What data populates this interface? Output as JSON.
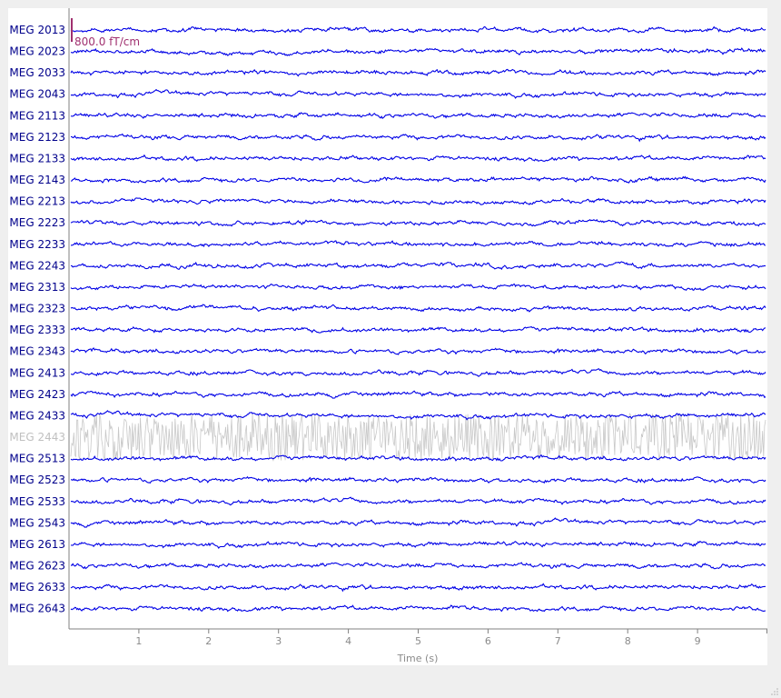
{
  "chart_data": {
    "type": "line",
    "title": "",
    "xlabel": "Time (s)",
    "ylabel": "",
    "xlim": [
      0,
      10
    ],
    "xticks": [
      1,
      2,
      3,
      4,
      5,
      6,
      7,
      8,
      9
    ],
    "scale_bar_label": "800.0 fT/cm",
    "channels": [
      {
        "name": "MEG 2013",
        "bad": false
      },
      {
        "name": "MEG 2023",
        "bad": false
      },
      {
        "name": "MEG 2033",
        "bad": false
      },
      {
        "name": "MEG 2043",
        "bad": false
      },
      {
        "name": "MEG 2113",
        "bad": false
      },
      {
        "name": "MEG 2123",
        "bad": false
      },
      {
        "name": "MEG 2133",
        "bad": false
      },
      {
        "name": "MEG 2143",
        "bad": false
      },
      {
        "name": "MEG 2213",
        "bad": false
      },
      {
        "name": "MEG 2223",
        "bad": false
      },
      {
        "name": "MEG 2233",
        "bad": false
      },
      {
        "name": "MEG 2243",
        "bad": false
      },
      {
        "name": "MEG 2313",
        "bad": false
      },
      {
        "name": "MEG 2323",
        "bad": false
      },
      {
        "name": "MEG 2333",
        "bad": false
      },
      {
        "name": "MEG 2343",
        "bad": false
      },
      {
        "name": "MEG 2413",
        "bad": false
      },
      {
        "name": "MEG 2423",
        "bad": false
      },
      {
        "name": "MEG 2433",
        "bad": false
      },
      {
        "name": "MEG 2443",
        "bad": true
      },
      {
        "name": "MEG 2513",
        "bad": false
      },
      {
        "name": "MEG 2523",
        "bad": false
      },
      {
        "name": "MEG 2533",
        "bad": false
      },
      {
        "name": "MEG 2543",
        "bad": false
      },
      {
        "name": "MEG 2613",
        "bad": false
      },
      {
        "name": "MEG 2623",
        "bad": false
      },
      {
        "name": "MEG 2633",
        "bad": false
      },
      {
        "name": "MEG 2643",
        "bad": false
      }
    ]
  },
  "colors": {
    "good_trace": "#0000e6",
    "good_label": "#00008b",
    "bad": "#c8c8c8",
    "bad_label": "#c0c0c0",
    "scale_bar": "#a0306f",
    "axis": "#808080",
    "tick_label": "#8a8a8a"
  },
  "icons": {
    "resize_grip": "resize-grip-icon"
  }
}
